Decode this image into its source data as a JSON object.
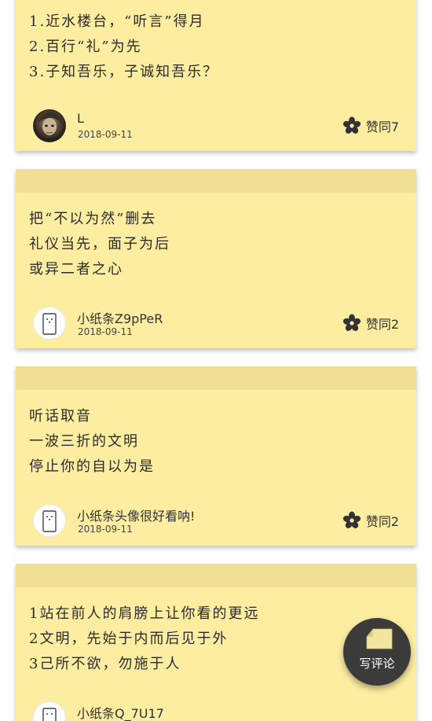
{
  "posts": [
    {
      "lines": [
        "1.近水楼台，“听言”得月",
        "2.百行“礼”为先",
        "3.子知吾乐，子诚知吾乐？"
      ],
      "author": "L",
      "date": "2018-09-11",
      "like_label": "赞同7",
      "avatar": "photo-avatar"
    },
    {
      "lines": [
        "把“不以为然”删去",
        "礼仪当先，面子为后",
        "或异二者之心"
      ],
      "author": "小纸条Z9pPeR",
      "date": "2018-09-11",
      "like_label": "赞同2",
      "avatar": "default-avatar"
    },
    {
      "lines": [
        "听话取音",
        "一波三折的文明",
        "停止你的自以为是"
      ],
      "author": "小纸条头像很好看呐!",
      "date": "2018-09-11",
      "like_label": "赞同2",
      "avatar": "default-avatar"
    },
    {
      "lines": [
        "1站在前人的肩膀上让你看的更远",
        "2文明，先始于内而后见于外",
        "3己所不欲，勿施于人"
      ],
      "author": "小纸条Q_7U17",
      "avatar": "default-avatar"
    }
  ],
  "fab": {
    "label": "写评论",
    "icon": "note-paper-icon"
  },
  "colors": {
    "card_background": "#fdeda1",
    "card_strip": "#f0de95",
    "fab_background": "#3b3b3b",
    "icon_dark": "#333333"
  },
  "icons": {
    "like": "flower-like-icon"
  }
}
